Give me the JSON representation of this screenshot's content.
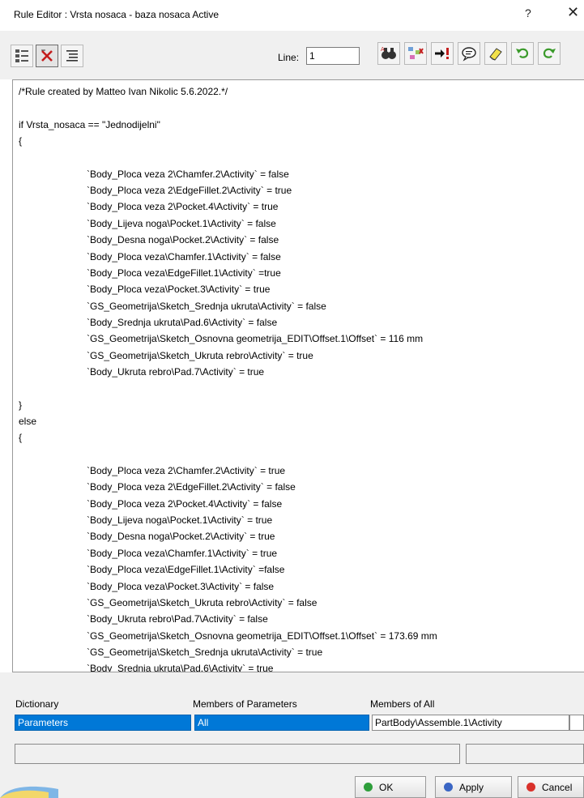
{
  "window": {
    "title": "Rule Editor : Vrsta nosaca - baza nosaca Active",
    "help_glyph": "?",
    "close_glyph": "✕"
  },
  "toolbar": {
    "line_label": "Line:",
    "line_value": "1",
    "left_icons": [
      "rule-tree-icon",
      "delete-rule-icon",
      "indent-text-icon"
    ],
    "right_icons": [
      "find-replace-icon",
      "diagnosis-icon",
      "jump-to-error-icon",
      "comment-icon",
      "eraser-icon",
      "undo-icon",
      "redo-icon"
    ]
  },
  "editor": {
    "lines": [
      "/*Rule created by Matteo Ivan Nikolic 5.6.2022.*/",
      "",
      "if Vrsta_nosaca == \"Jednodijelni\"",
      "{",
      "",
      "`Body_Ploca veza 2\\Chamfer.2\\Activity` = false",
      "`Body_Ploca veza 2\\EdgeFillet.2\\Activity` = true",
      "`Body_Ploca veza 2\\Pocket.4\\Activity` = true",
      "`Body_Lijeva noga\\Pocket.1\\Activity` = false",
      "`Body_Desna noga\\Pocket.2\\Activity` = false",
      "`Body_Ploca veza\\Chamfer.1\\Activity` = false",
      "`Body_Ploca veza\\EdgeFillet.1\\Activity` =true",
      "`Body_Ploca veza\\Pocket.3\\Activity` = true",
      "`GS_Geometrija\\Sketch_Srednja ukruta\\Activity` = false",
      "`Body_Srednja ukruta\\Pad.6\\Activity` = false",
      "`GS_Geometrija\\Sketch_Osnovna geometrija_EDIT\\Offset.1\\Offset` = 116 mm",
      "`GS_Geometrija\\Sketch_Ukruta rebro\\Activity` = true",
      "`Body_Ukruta rebro\\Pad.7\\Activity` = true",
      "",
      "}",
      "else",
      "{",
      "",
      "`Body_Ploca veza 2\\Chamfer.2\\Activity` = true",
      "`Body_Ploca veza 2\\EdgeFillet.2\\Activity` = false",
      "`Body_Ploca veza 2\\Pocket.4\\Activity` = false",
      "`Body_Lijeva noga\\Pocket.1\\Activity` = true",
      "`Body_Desna noga\\Pocket.2\\Activity` = true",
      "`Body_Ploca veza\\Chamfer.1\\Activity` = true",
      "`Body_Ploca veza\\EdgeFillet.1\\Activity` =false",
      "`Body_Ploca veza\\Pocket.3\\Activity` = false",
      "`GS_Geometrija\\Sketch_Ukruta rebro\\Activity` = false",
      "`Body_Ukruta rebro\\Pad.7\\Activity` = false",
      "`GS_Geometrija\\Sketch_Osnovna geometrija_EDIT\\Offset.1\\Offset` = 173.69 mm",
      "`GS_Geometrija\\Sketch_Srednja ukruta\\Activity` = true",
      "`Body_Srednja ukruta\\Pad.6\\Activity` = true",
      "",
      "}"
    ]
  },
  "dictionary": {
    "dictionary_label": "Dictionary",
    "dictionary_value": "Parameters",
    "members_params_label": "Members of Parameters",
    "members_params_value": "All",
    "members_all_label": "Members of All",
    "members_all_value": "PartBody\\Assemble.1\\Activity"
  },
  "buttons": {
    "ok_label": "OK",
    "apply_label": "Apply",
    "cancel_label": "Cancel"
  },
  "colors": {
    "selection": "#0078d7",
    "ok_dot": "#2e9e3b",
    "apply_dot": "#3a66c4",
    "cancel_dot": "#d9312b"
  }
}
